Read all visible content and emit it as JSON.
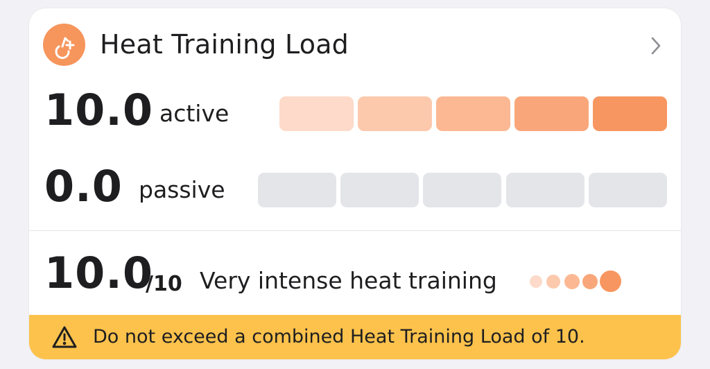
{
  "header": {
    "title": "Heat Training Load",
    "icon": "heat-training-icon",
    "chevron_icon": "chevron-right-icon",
    "accent_color": "#f6955c"
  },
  "active": {
    "value": "10.0",
    "label": "active",
    "segments_filled": 5,
    "segments_total": 5,
    "segment_colors": [
      "#fddac9",
      "#fcc9ad",
      "#fbb893",
      "#f9a77a",
      "#f79660"
    ]
  },
  "passive": {
    "value": "0.0",
    "label": "passive",
    "segments_filled": 0,
    "segments_total": 5,
    "empty_color": "#e4e5e9"
  },
  "combined": {
    "value": "10.0",
    "out_of": "/10",
    "description": "Very intense heat training",
    "dots_filled": 5,
    "dots_total": 5,
    "dot_colors": [
      "#fddac9",
      "#fcc9ad",
      "#fbb893",
      "#f9a77a",
      "#f79660"
    ]
  },
  "warning": {
    "icon": "warning-triangle-icon",
    "text": "Do not exceed a combined Heat Training Load of 10.",
    "background": "#fcc24c"
  }
}
